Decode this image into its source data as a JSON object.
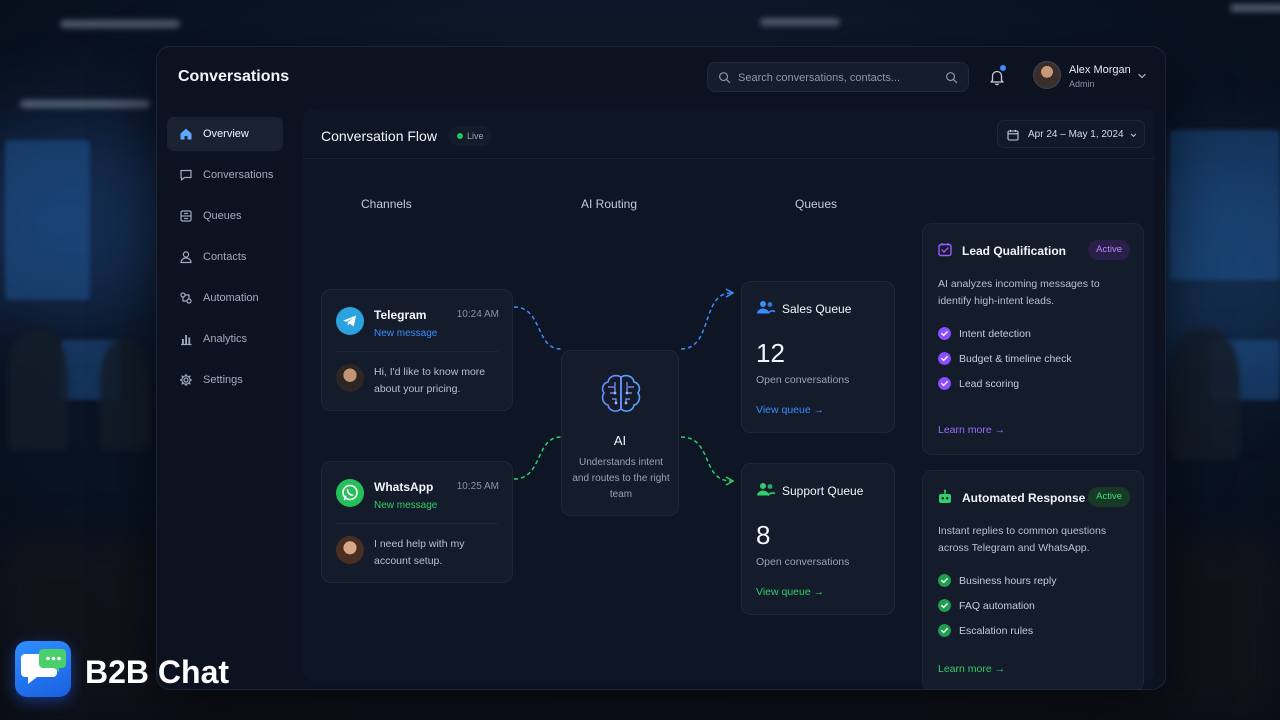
{
  "app": {
    "title": "Conversations"
  },
  "search": {
    "placeholder": "Search conversations, contacts..."
  },
  "user": {
    "name": "Alex Morgan",
    "role": "Admin"
  },
  "sidebar": {
    "items": [
      {
        "label": "Overview",
        "icon": "home-icon",
        "active": true
      },
      {
        "label": "Conversations",
        "icon": "chat-icon"
      },
      {
        "label": "Queues",
        "icon": "queue-icon"
      },
      {
        "label": "Contacts",
        "icon": "contact-icon"
      },
      {
        "label": "Automation",
        "icon": "automation-icon"
      },
      {
        "label": "Analytics",
        "icon": "analytics-icon"
      },
      {
        "label": "Settings",
        "icon": "gear-icon"
      }
    ]
  },
  "main": {
    "title": "Conversation Flow",
    "live_label": "Live",
    "date_range": "Apr 24 – May 1, 2024",
    "columns": {
      "channels": "Channels",
      "routing": "AI Routing",
      "queues": "Queues"
    }
  },
  "channels": [
    {
      "name": "Telegram",
      "time": "10:24 AM",
      "status": "New message",
      "message": "Hi, I'd like to know more about your pricing.",
      "icon": "telegram-icon",
      "color": "#2aa3e0"
    },
    {
      "name": "WhatsApp",
      "time": "10:25 AM",
      "status": "New message",
      "message": "I need help with my account setup.",
      "icon": "whatsapp-icon",
      "color": "#25c05a"
    }
  ],
  "ai": {
    "name": "AI",
    "description": "Understands intent and routes to the right team"
  },
  "queues": [
    {
      "name": "Sales Queue",
      "count": "12",
      "sub": "Open conversations",
      "link": "View queue →",
      "color": "#3b8cff"
    },
    {
      "name": "Support Queue",
      "count": "8",
      "sub": "Open conversations",
      "link": "View queue →",
      "color": "#2fd06a"
    }
  ],
  "features": [
    {
      "title": "Lead Qualification",
      "badge": "Active",
      "description": "AI analyzes incoming messages to identify high-intent leads.",
      "items": [
        "Intent detection",
        "Budget & timeline check",
        "Lead scoring"
      ],
      "link": "Learn more →",
      "color": "#9b5cff"
    },
    {
      "title": "Automated Response",
      "badge": "Active",
      "description": "Instant replies to common questions across Telegram and WhatsApp.",
      "items": [
        "Business hours reply",
        "FAQ automation",
        "Escalation rules"
      ],
      "link": "Learn more →",
      "color": "#2fd06a"
    }
  ],
  "brand": {
    "name": "B2B Chat"
  },
  "colors": {
    "accent_blue": "#3b8cff",
    "accent_green": "#2fd06a",
    "accent_purple": "#9b5cff",
    "live": "#22c55e"
  }
}
